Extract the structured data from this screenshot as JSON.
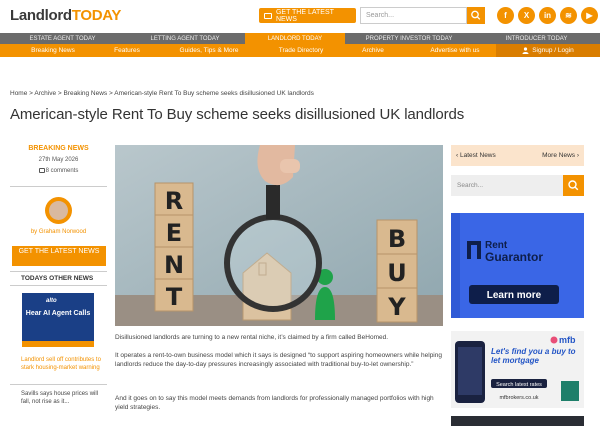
{
  "header": {
    "logo_part1": "Landlord",
    "logo_part2": "TODAY",
    "news_button": "GET THE LATEST NEWS",
    "search_placeholder": "Search...",
    "social_icons": [
      "facebook-icon",
      "x-icon",
      "linkedin-icon",
      "spotify-icon",
      "youtube-icon"
    ]
  },
  "nav_top": [
    "ESTATE AGENT TODAY",
    "LETTING AGENT TODAY",
    "LANDLORD TODAY",
    "PROPERTY INVESTOR TODAY",
    "INTRODUCER TODAY"
  ],
  "nav_main": [
    "Breaking News",
    "Features",
    "Guides, Tips & More",
    "Trade Directory",
    "Archive",
    "Advertise with us",
    "Signup / Login"
  ],
  "breadcrumb": "Home > Archive > Breaking News > American-style Rent To Buy scheme seeks disillusioned UK landlords",
  "article": {
    "title": "American-style Rent To Buy scheme seeks disillusioned UK landlords",
    "category": "BREAKING NEWS",
    "date": "27th May 2026",
    "comments": "8 comments",
    "author": "by Graham Norwood",
    "paragraphs": [
      "Disillusioned landlords are turning to a new rental niche, it’s claimed by a firm called BeHomed.",
      "It operates a rent-to-own business model which it says is designed “to support aspiring homeowners while helping landlords reduce the day-to-day pressures increasingly associated with traditional buy-to-let ownership.”",
      "And it goes on to say this model meets demands from landlords for professionally managed portfolios with high yield strategies."
    ]
  },
  "image_letters": {
    "left": [
      "R",
      "E",
      "N",
      "T"
    ],
    "right": [
      "B",
      "U",
      "Y"
    ]
  },
  "left_column": {
    "news_button": "GET THE LATEST NEWS",
    "today_heading": "TODAYS OTHER NEWS",
    "ad_thumb_text": "Hear AI Agent Calls",
    "ad_thumb_logo": "alto",
    "headline_1": "Landlord sell off contributes to stark housing-market warning",
    "headline_2": "Savills says house prices will fall, not rise as it..."
  },
  "right_column": {
    "latest_news": "Latest News",
    "more_news": "More News",
    "search_placeholder": "Search...",
    "rg_ad": {
      "brand_line1": "Rent",
      "brand_line2": "Guarantor",
      "cta": "Learn more"
    },
    "mfb_ad": {
      "logo": "mfb",
      "headline": "Let's find you a buy to let mortgage",
      "cta": "Search latest rates",
      "url": "mfbrokers.co.uk"
    }
  },
  "colors": {
    "accent": "#f39200",
    "nav_dark": "#6b6b6b",
    "rg_blue": "#2f5ad6"
  }
}
